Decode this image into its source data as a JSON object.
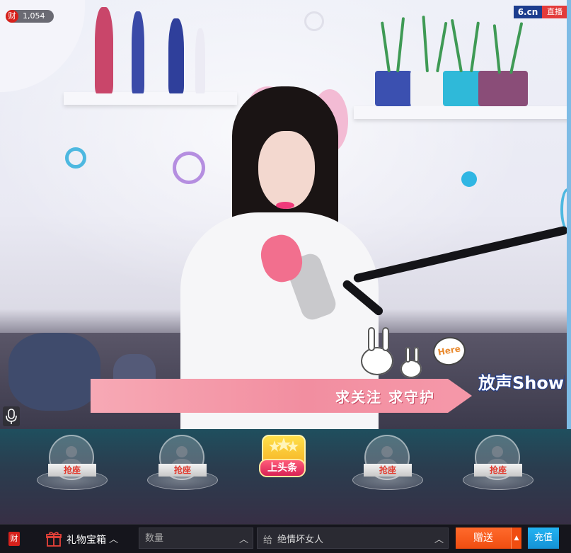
{
  "overlay": {
    "wealth_icon_label": "财",
    "wealth_count": "1,054",
    "brand_site": "6.cn",
    "brand_live": "直播",
    "banner_text": "求关注 求守护",
    "here_badge": "Here",
    "show_logo": "放声Show唱"
  },
  "seats": [
    {
      "label": "抢座"
    },
    {
      "label": "抢座"
    },
    {
      "label": "抢座"
    },
    {
      "label": "抢座"
    }
  ],
  "headline": {
    "label": "上头条"
  },
  "bottom_bar": {
    "wealth_icon_label": "财",
    "gift_box_label": "礼物宝箱",
    "quantity_placeholder": "数量",
    "recipient_prefix": "给",
    "recipient_value": "绝情坏女人",
    "send_label": "赠送",
    "recharge_label": "充值"
  },
  "icons": {
    "gift": "gift-icon",
    "chevron": "chevron-up-icon",
    "mic": "microphone-icon",
    "avatar": "user-avatar-icon"
  },
  "colors": {
    "send": "#f04d10",
    "recharge": "#1592d6",
    "live_badge": "#e33b3b",
    "brand": "#1c3d8e"
  }
}
